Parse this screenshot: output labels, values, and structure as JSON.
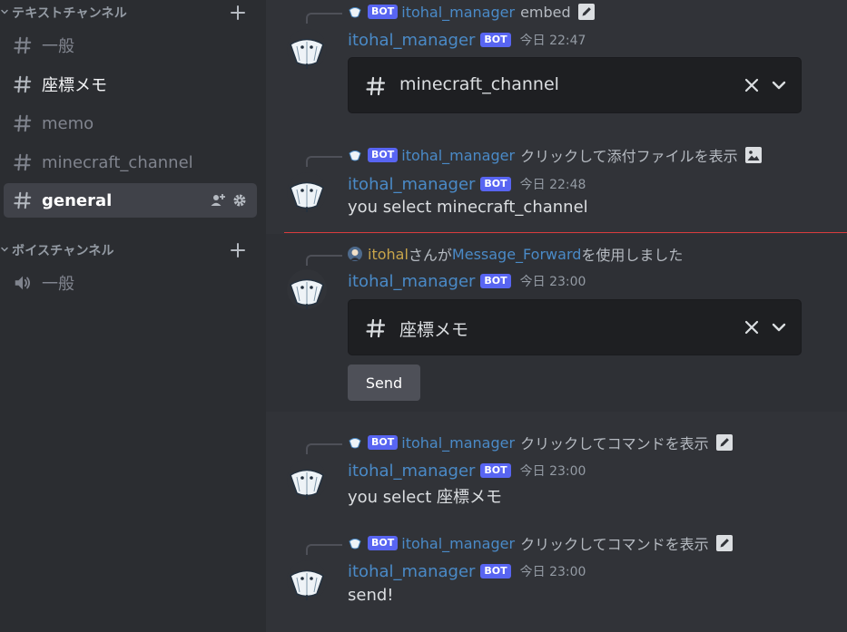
{
  "sidebar": {
    "text_category": "テキストチャンネル",
    "voice_category": "ボイスチャンネル",
    "text_channels": [
      {
        "name": "一般",
        "state": "muted"
      },
      {
        "name": "座標メモ",
        "state": "unread"
      },
      {
        "name": "memo",
        "state": "muted"
      },
      {
        "name": "minecraft_channel",
        "state": "muted"
      },
      {
        "name": "general",
        "state": "selected"
      }
    ],
    "voice_channels": [
      {
        "name": "一般"
      }
    ]
  },
  "messages": [
    {
      "reply": {
        "badge": "BOT",
        "user": "itohal_manager",
        "text": "embed",
        "icon": "pencil-icon"
      },
      "author": "itohal_manager",
      "badge": "BOT",
      "time": "今日 22:47",
      "select": {
        "value": "minecraft_channel"
      }
    },
    {
      "reply": {
        "badge": "BOT",
        "user": "itohal_manager",
        "text": "クリックして添付ファイルを表示",
        "icon": "image-icon"
      },
      "author": "itohal_manager",
      "badge": "BOT",
      "time": "今日 22:48",
      "text": "you select minecraft_channel"
    },
    {
      "reply": {
        "user": "itohal",
        "suffix1": "さんが",
        "command": "Message_Forward",
        "suffix2": "を使用しました"
      },
      "author": "itohal_manager",
      "badge": "BOT",
      "time": "今日 23:00",
      "select": {
        "value": "座標メモ"
      },
      "button": "Send"
    },
    {
      "reply": {
        "badge": "BOT",
        "user": "itohal_manager",
        "text": "クリックしてコマンドを表示",
        "icon": "pencil-icon"
      },
      "author": "itohal_manager",
      "badge": "BOT",
      "time": "今日 23:00",
      "text": "you select 座標メモ"
    },
    {
      "reply": {
        "badge": "BOT",
        "user": "itohal_manager",
        "text": "クリックしてコマンドを表示",
        "icon": "pencil-icon"
      },
      "author": "itohal_manager",
      "badge": "BOT",
      "time": "今日 23:00",
      "text": "send!"
    }
  ],
  "colors": {
    "background": "#313338",
    "sidebar": "#2b2d31",
    "selected_channel": "#404249",
    "bot_badge": "#5865f2",
    "username": "#4a8ac7",
    "new_divider": "#d83c3e",
    "select_menu": "#1e1f22",
    "send_button": "#4e5058"
  }
}
